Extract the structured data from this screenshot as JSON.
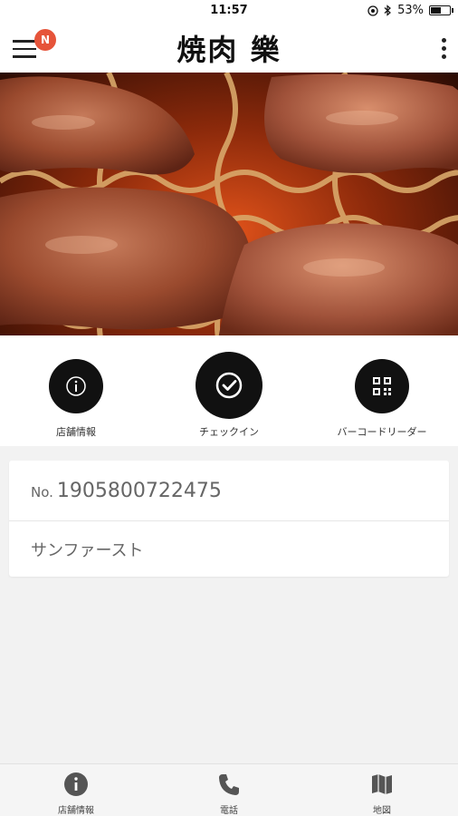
{
  "status_bar": {
    "time": "11:57",
    "battery_text": "53%",
    "battery_level": 0.53,
    "icons": [
      "location-icon",
      "bluetooth-icon"
    ]
  },
  "header": {
    "menu_icon": "hamburger-menu-icon",
    "notification_badge": "N",
    "brand": "焼肉 樂",
    "more_icon": "more-vertical-icon",
    "badge_color": "#e6543a"
  },
  "hero": {
    "description_icon": "grilled-meat-photo"
  },
  "actions": [
    {
      "label": "店舗情報",
      "icon": "info-icon"
    },
    {
      "label": "チェックイン",
      "icon": "checkmark-circle-icon"
    },
    {
      "label": "バーコードリーダー",
      "icon": "qr-code-icon"
    }
  ],
  "member_card": {
    "number_prefix": "No.",
    "number": "1905800722475",
    "store_name": "サンファースト"
  },
  "bottom_nav": [
    {
      "label": "店舗情報",
      "icon": "info-icon"
    },
    {
      "label": "電話",
      "icon": "phone-icon"
    },
    {
      "label": "地図",
      "icon": "map-icon"
    }
  ],
  "colors": {
    "background": "#f2f2f2",
    "action_circle": "#111111"
  }
}
